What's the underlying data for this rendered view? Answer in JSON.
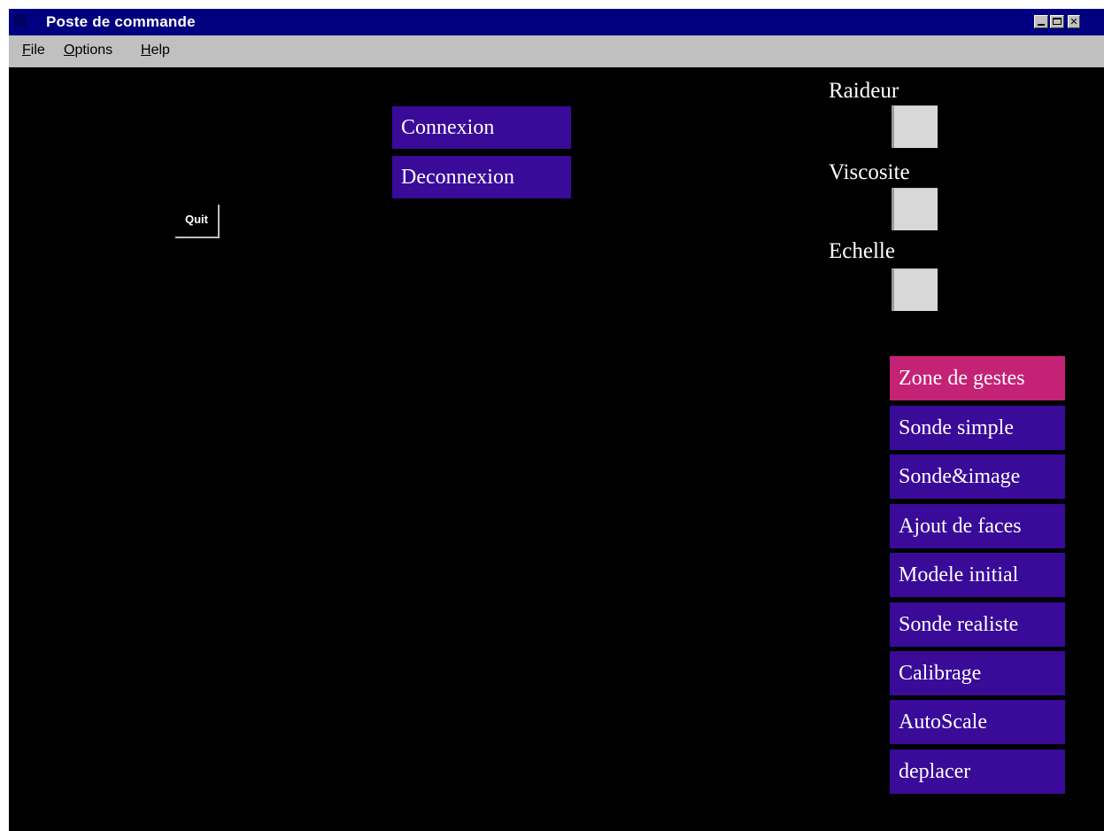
{
  "window": {
    "title": "Poste de commande",
    "controls": {
      "minimize": "",
      "maximize": "",
      "close": "✕"
    }
  },
  "menubar": {
    "items": [
      "File",
      "Options",
      "Help"
    ]
  },
  "main": {
    "quit_label": "Quit",
    "connection_buttons": [
      "Connexion",
      "Deconnexion"
    ],
    "parameters": [
      {
        "label": "Raideur",
        "value": ""
      },
      {
        "label": "Viscosite",
        "value": ""
      },
      {
        "label": "Echelle",
        "value": ""
      }
    ],
    "mode_buttons": [
      {
        "label": "Zone de gestes",
        "active": true
      },
      {
        "label": "Sonde simple",
        "active": false
      },
      {
        "label": "Sonde&image",
        "active": false
      },
      {
        "label": "Ajout de faces",
        "active": false
      },
      {
        "label": "Modele initial",
        "active": false
      },
      {
        "label": "Sonde realiste",
        "active": false
      },
      {
        "label": "Calibrage",
        "active": false
      },
      {
        "label": "AutoScale",
        "active": false
      },
      {
        "label": "deplacer",
        "active": false
      }
    ]
  },
  "colors": {
    "titlebar": "#000080",
    "button_purple": "#3a0a99",
    "button_active_pink": "#c42275",
    "client_background": "#000000",
    "chrome_gray": "#c0c0c0"
  },
  "icons": {
    "app_icon": "app-icon",
    "minimize": "minimize-icon",
    "maximize": "maximize-icon",
    "close": "close-icon"
  }
}
